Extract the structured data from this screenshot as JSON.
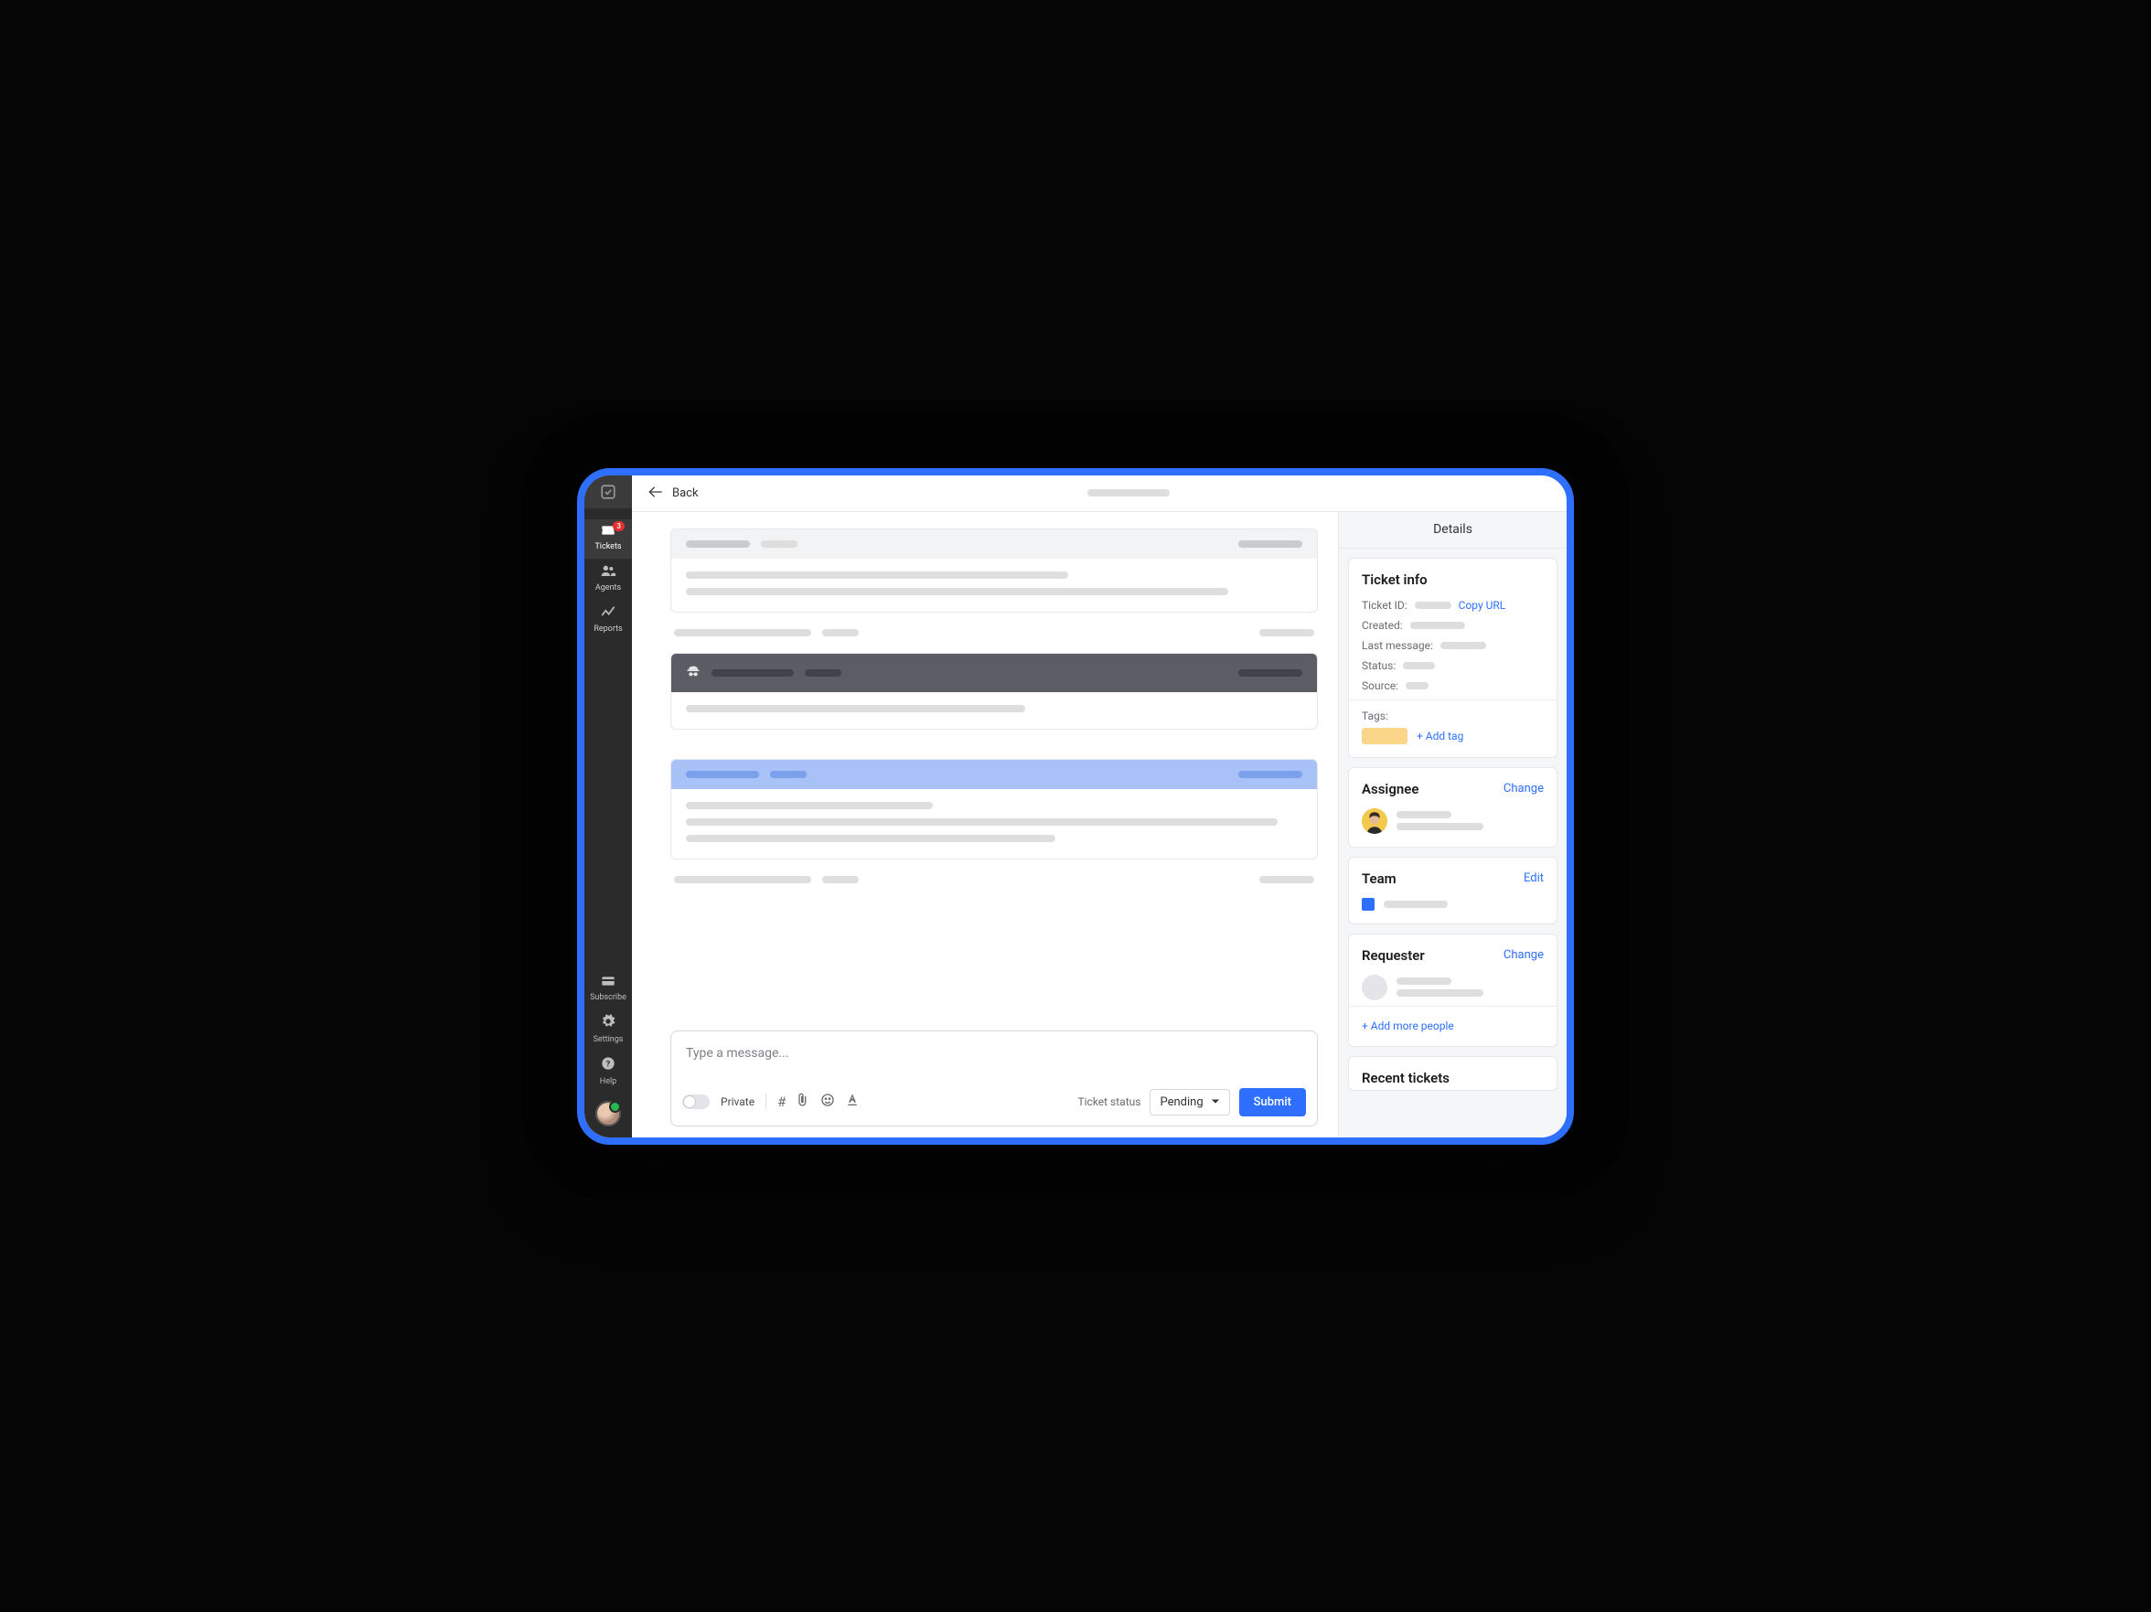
{
  "sidebar": {
    "items": [
      {
        "label": "Tickets",
        "badge": "3"
      },
      {
        "label": "Agents"
      },
      {
        "label": "Reports"
      }
    ],
    "bottom": {
      "subscribe": "Subscribe",
      "settings": "Settings",
      "help": "Help"
    }
  },
  "topbar": {
    "back": "Back"
  },
  "composer": {
    "placeholder": "Type a message...",
    "private_label": "Private",
    "status_label": "Ticket status",
    "status_value": "Pending",
    "submit": "Submit"
  },
  "details": {
    "title": "Details",
    "ticket_info": {
      "title": "Ticket info",
      "ticket_id_label": "Ticket ID:",
      "copy_url": "Copy URL",
      "created_label": "Created:",
      "last_message_label": "Last message:",
      "status_label": "Status:",
      "source_label": "Source:",
      "tags_label": "Tags:",
      "add_tag": "+ Add tag"
    },
    "assignee": {
      "title": "Assignee",
      "change": "Change"
    },
    "team": {
      "title": "Team",
      "edit": "Edit"
    },
    "requester": {
      "title": "Requester",
      "change": "Change",
      "add_people": "+ Add more people"
    },
    "recent": {
      "title": "Recent tickets"
    }
  }
}
